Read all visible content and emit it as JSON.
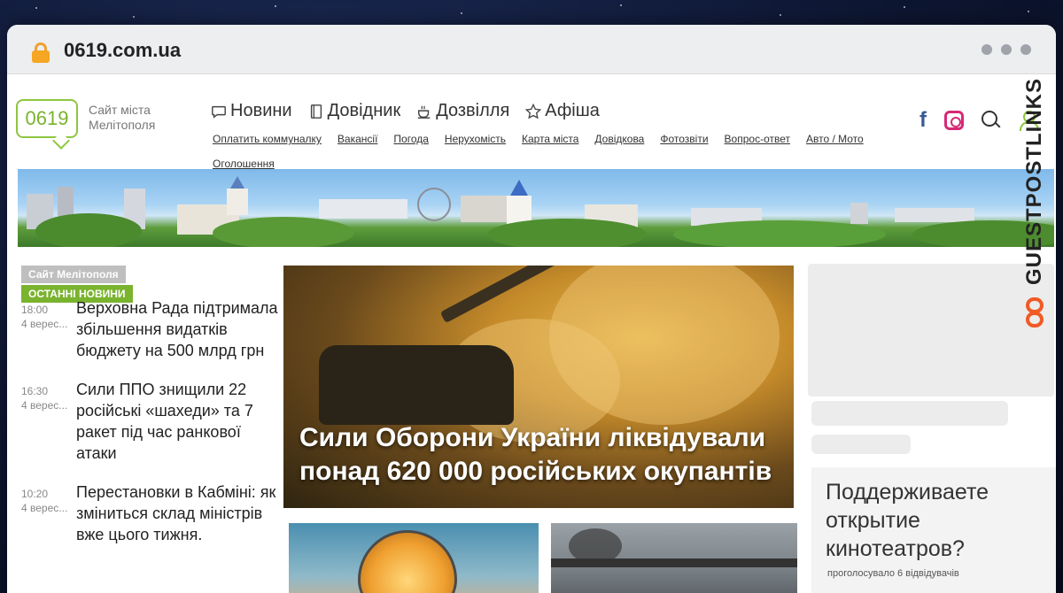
{
  "browser": {
    "url": "0619.com.ua"
  },
  "logo": {
    "number": "0619",
    "tagline": "Сайт міста Мелітополя"
  },
  "main_nav": [
    {
      "label": "Новини",
      "icon": "chat-icon"
    },
    {
      "label": "Довідник",
      "icon": "book-icon"
    },
    {
      "label": "Дозвілля",
      "icon": "coffee-icon"
    },
    {
      "label": "Афіша",
      "icon": "star-icon"
    }
  ],
  "sub_nav": [
    "Оплатить коммуналку",
    "Вакансії",
    "Погода",
    "Нерухомість",
    "Карта міста",
    "Довідкова",
    "Фотозвіти",
    "Вопрос-ответ",
    "Авто / Мото",
    "Оголошення"
  ],
  "social": {
    "facebook": "f",
    "colors": {
      "facebook": "#3b5998",
      "instagram": "#d62976",
      "accent": "#7ab32e"
    }
  },
  "sidebar": {
    "site_label": "Сайт Мелітополя",
    "section_label": "ОСТАННІ НОВИНИ",
    "news": [
      {
        "time": "18:00",
        "date": "4 верес...",
        "title": "Верховна Рада підтримала збільшення видатків бюджету на 500 млрд грн"
      },
      {
        "time": "16:30",
        "date": "4 верес...",
        "title": "Сили ППО знищили 22 російські «шахеди» та 7 ракет під час ранкової атаки"
      },
      {
        "time": "10:20",
        "date": "4 верес...",
        "title": "Перестановки в Кабміні: як зміниться склад міністрів вже цього тижня."
      }
    ]
  },
  "hero": {
    "title": "Сили Оборони України ліквідували понад 620 000 російських окупантів"
  },
  "poll": {
    "question": "Поддерживаете открытие кинотеатров?",
    "votes": "проголосувало 6 відвідувачів"
  },
  "watermark": {
    "text": "GUESTPOSTLINKS"
  }
}
